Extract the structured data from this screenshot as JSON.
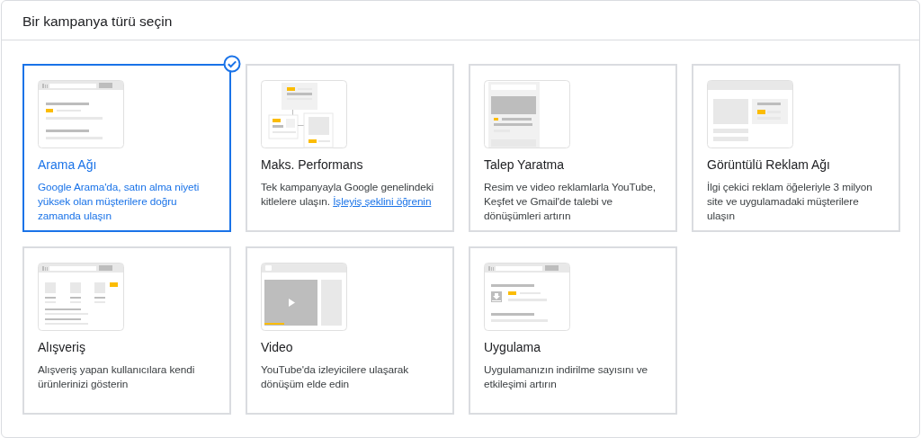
{
  "header": {
    "title": "Bir kampanya türü seçin"
  },
  "cards": [
    {
      "kind": "search",
      "title": "Arama Ağı",
      "description": "Google Arama'da, satın alma niyeti yüksek olan müşterilere doğru zamanda ulaşın",
      "selected": true
    },
    {
      "kind": "pmax",
      "title": "Maks. Performans",
      "description": "Tek kampanyayla Google genelindeki kitlelere ulaşın.",
      "link": "İşleyiş şeklini öğrenin",
      "selected": false
    },
    {
      "kind": "demand",
      "title": "Talep Yaratma",
      "description": "Resim ve video reklamlarla YouTube, Keşfet ve Gmail'de talebi ve dönüşümleri artırın",
      "selected": false
    },
    {
      "kind": "display",
      "title": "Görüntülü Reklam Ağı",
      "description": "İlgi çekici reklam öğeleriyle 3 milyon site ve uygulamadaki müşterilere ulaşın",
      "selected": false
    },
    {
      "kind": "shopping",
      "title": "Alışveriş",
      "description": "Alışveriş yapan kullanıcılara kendi ürünlerinizi gösterin",
      "selected": false
    },
    {
      "kind": "video",
      "title": "Video",
      "description": "YouTube'da izleyicilere ulaşarak dönüşüm elde edin",
      "selected": false
    },
    {
      "kind": "app",
      "title": "Uygulama",
      "description": "Uygulamanızın indirilme sayısını ve etkileşimi artırın",
      "selected": false
    }
  ]
}
